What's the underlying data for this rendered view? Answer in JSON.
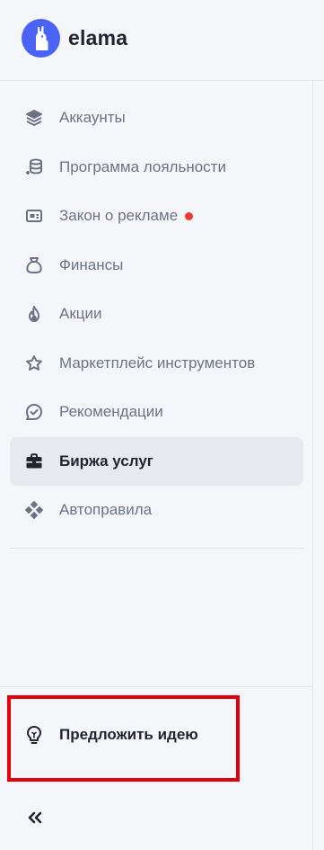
{
  "brand": {
    "name": "elama",
    "logo_icon": "llama-icon",
    "color": "#4b63f5"
  },
  "menu": {
    "items": [
      {
        "label": "Аккаунты",
        "icon": "layers-icon"
      },
      {
        "label": "Программа лояльности",
        "icon": "coins-icon"
      },
      {
        "label": "Закон о рекламе",
        "icon": "id-card-icon",
        "notification_dot": true
      },
      {
        "label": "Финансы",
        "icon": "money-bag-icon"
      },
      {
        "label": "Акции",
        "icon": "flame-icon"
      },
      {
        "label": "Маркетплейс инструментов",
        "icon": "star-icon"
      },
      {
        "label": "Рекомендации",
        "icon": "check-chat-icon"
      },
      {
        "label": "Биржа услуг",
        "icon": "briefcase-icon",
        "active": true
      },
      {
        "label": "Автоправила",
        "icon": "diamond-nodes-icon"
      }
    ]
  },
  "footer": {
    "idea_label": "Предложить идею",
    "idea_icon": "lightbulb-icon",
    "collapse_icon": "double-chevron-left-icon",
    "collapse_glyph": "«"
  },
  "colors": {
    "background": "#f5f6f9",
    "active_item_bg": "#e6e9ef",
    "text_muted": "#6b7383",
    "text_dark": "#1f2430",
    "notification": "#ee3b31",
    "highlight": "#e3000b"
  }
}
